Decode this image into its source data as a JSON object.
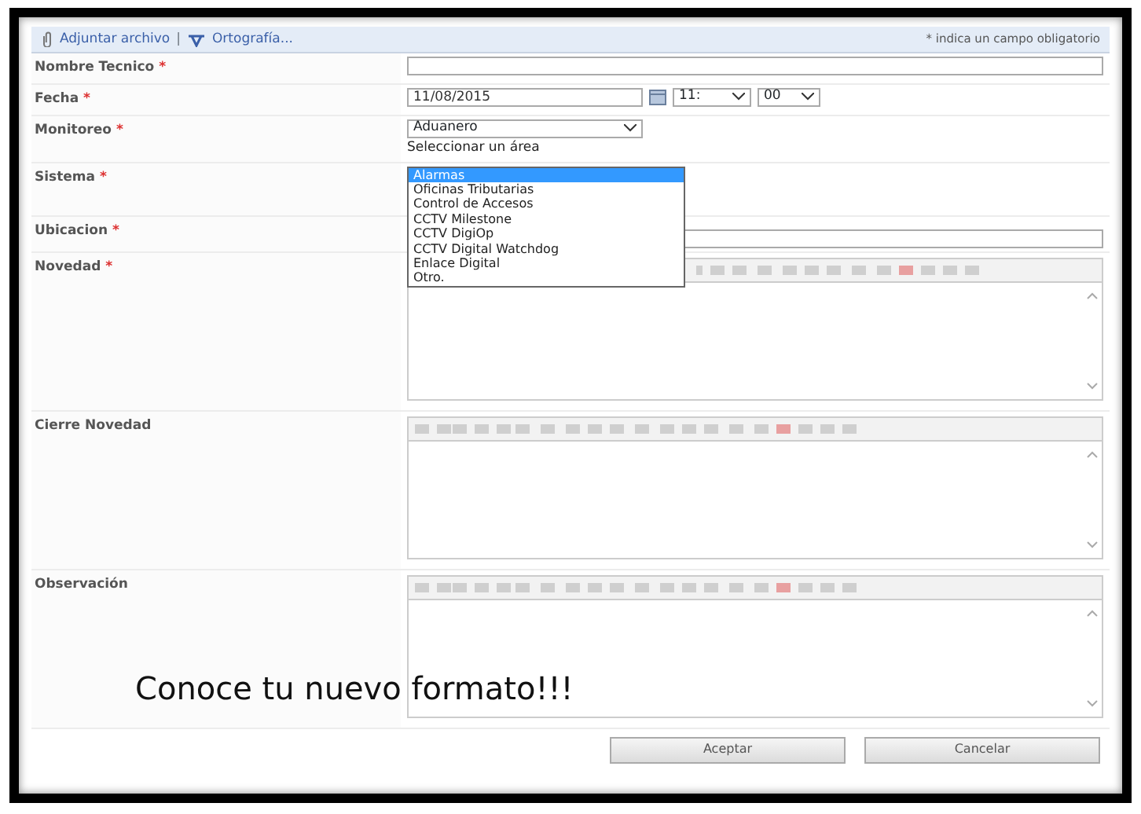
{
  "toolbar": {
    "attach": "Adjuntar archivo",
    "separator": "|",
    "spelling": "Ortografía...",
    "note": "* indica un campo obligatorio"
  },
  "fields": [
    {
      "kind": "text",
      "label": "Nombre Tecnico",
      "required_mark": "*"
    },
    {
      "kind": "datetime",
      "label": "Fecha",
      "required_mark": "*",
      "date": "11/08/2015",
      "hour": "11:",
      "minute": "00"
    },
    {
      "kind": "select",
      "label": "Monitoreo",
      "required_mark": "*",
      "value": "Aduanero",
      "hint": "Seleccionar un área"
    },
    {
      "kind": "dropdown",
      "label": "Sistema",
      "required_mark": "*",
      "options": [
        {
          "label": "Alarmas",
          "selected": true
        },
        {
          "label": "Oficinas Tributarias",
          "selected": false
        },
        {
          "label": "Control de Accesos",
          "selected": false
        },
        {
          "label": "CCTV Milestone",
          "selected": false
        },
        {
          "label": "CCTV DigiOp",
          "selected": false
        },
        {
          "label": "CCTV Digital Watchdog",
          "selected": false
        },
        {
          "label": "Enlace Digital",
          "selected": false
        },
        {
          "label": "Otro.",
          "selected": false
        }
      ]
    },
    {
      "kind": "text",
      "label": "Ubicacion",
      "required_mark": "*"
    },
    {
      "kind": "editor",
      "label": "Novedad",
      "required_mark": "*"
    },
    {
      "kind": "editor",
      "label": "Cierre Novedad"
    },
    {
      "kind": "editor",
      "label": "Observación"
    }
  ],
  "caption": "Conoce tu nuevo formato!!!",
  "buttons": [
    "Aceptar",
    "Cancelar"
  ]
}
